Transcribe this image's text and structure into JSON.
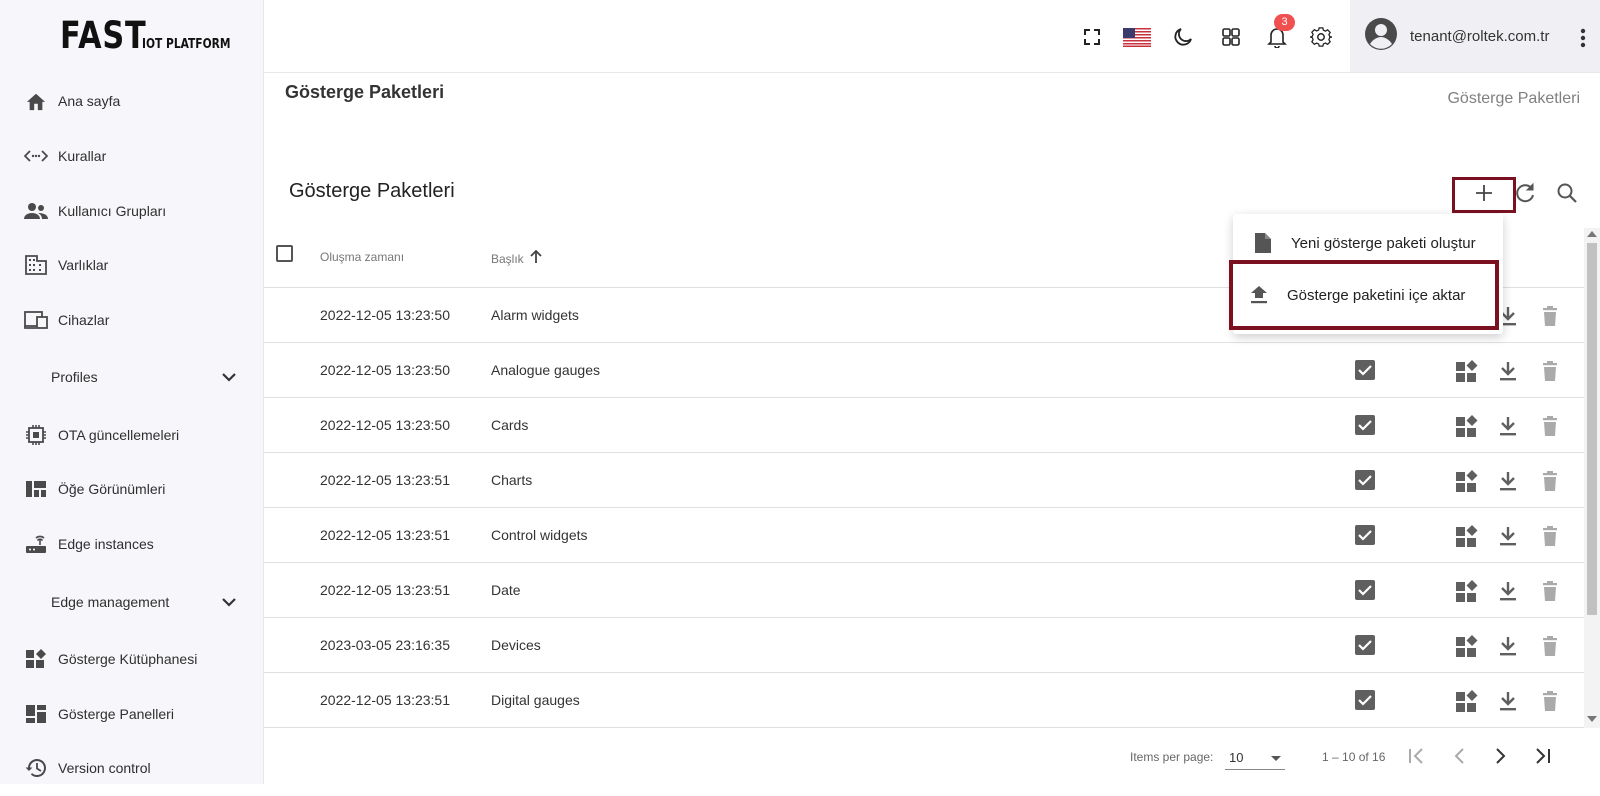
{
  "logo": {
    "big": "FAST",
    "small": "IOT PLATFORM"
  },
  "sidebar": {
    "items": [
      {
        "label": "Ana sayfa",
        "icon": "home-icon"
      },
      {
        "label": "Kurallar",
        "icon": "rule-chain-icon"
      },
      {
        "label": "Kullanıcı Grupları",
        "icon": "user-group-icon"
      },
      {
        "label": "Varlıklar",
        "icon": "building-icon"
      },
      {
        "label": "Cihazlar",
        "icon": "devices-icon"
      },
      {
        "label": "Profiles",
        "icon": "chevron-down-icon",
        "group": true
      },
      {
        "label": "OTA güncellemeleri",
        "icon": "chip-icon"
      },
      {
        "label": "Öğe Görünümleri",
        "icon": "view-quilt-icon"
      },
      {
        "label": "Edge instances",
        "icon": "router-icon"
      },
      {
        "label": "Edge management",
        "icon": "chevron-down-icon",
        "group": true
      },
      {
        "label": "Gösterge Kütüphanesi",
        "icon": "widgets-icon"
      },
      {
        "label": "Gösterge Panelleri",
        "icon": "dashboard-icon"
      },
      {
        "label": "Version control",
        "icon": "history-icon"
      }
    ]
  },
  "topbar": {
    "notifications_count": "3",
    "user_email": "tenant@roltek.com.tr",
    "icons": [
      "fullscreen-icon",
      "us-flag-icon",
      "dark-mode-icon",
      "apps-icon",
      "notification-bell-icon",
      "settings-icon",
      "account-icon",
      "more-vert-icon"
    ]
  },
  "page": {
    "title": "Gösterge Paketleri",
    "breadcrumb": "Gösterge Paketleri"
  },
  "card": {
    "title": "Gösterge Paketleri"
  },
  "table": {
    "headers": {
      "created": "Oluşma zamanı",
      "title": "Başlık"
    },
    "rows": [
      {
        "created": "2022-12-05 13:23:50",
        "title": "Alarm widgets",
        "system": true
      },
      {
        "created": "2022-12-05 13:23:50",
        "title": "Analogue gauges",
        "system": true
      },
      {
        "created": "2022-12-05 13:23:50",
        "title": "Cards",
        "system": true
      },
      {
        "created": "2022-12-05 13:23:51",
        "title": "Charts",
        "system": true
      },
      {
        "created": "2022-12-05 13:23:51",
        "title": "Control widgets",
        "system": true
      },
      {
        "created": "2022-12-05 13:23:51",
        "title": "Date",
        "system": true
      },
      {
        "created": "2023-03-05 23:16:35",
        "title": "Devices",
        "system": true
      },
      {
        "created": "2022-12-05 13:23:51",
        "title": "Digital gauges",
        "system": true
      }
    ]
  },
  "menu": {
    "items": [
      {
        "label": "Yeni gösterge paketi oluştur",
        "icon": "file-icon"
      },
      {
        "label": "Gösterge paketini içe aktar",
        "icon": "upload-icon"
      }
    ]
  },
  "paginator": {
    "items_per_page_label": "Items per page:",
    "page_size": "10",
    "range": "1 – 10 of 16"
  },
  "colors": {
    "highlight": "#7a1020",
    "badge": "#f05050",
    "icon": "#5f5f5f"
  }
}
